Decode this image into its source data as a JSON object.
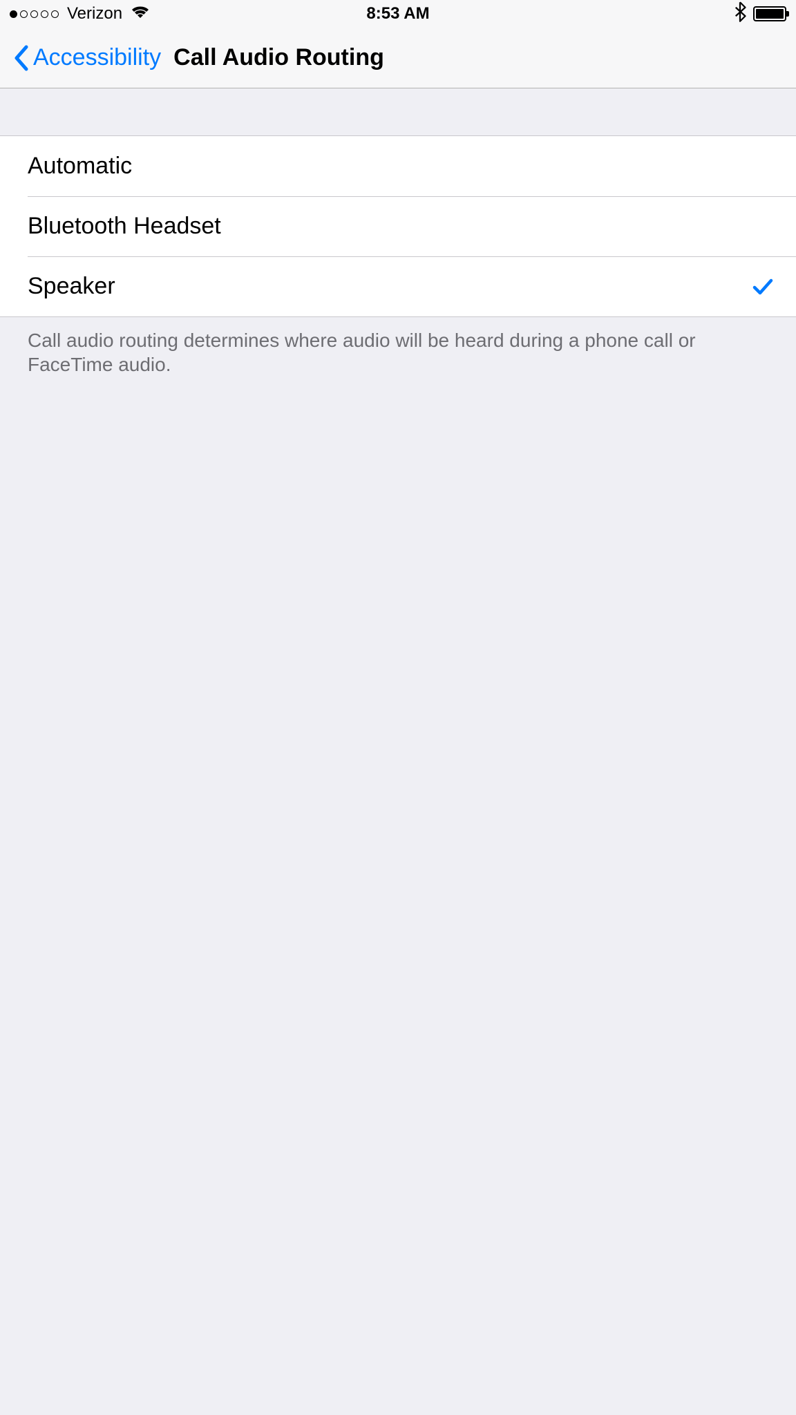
{
  "status_bar": {
    "carrier": "Verizon",
    "time": "8:53 AM"
  },
  "nav": {
    "back_label": "Accessibility",
    "title": "Call Audio Routing"
  },
  "options": {
    "automatic": "Automatic",
    "bluetooth": "Bluetooth Headset",
    "speaker": "Speaker"
  },
  "footer": "Call audio routing determines where audio will be heard during a phone call or FaceTime audio."
}
